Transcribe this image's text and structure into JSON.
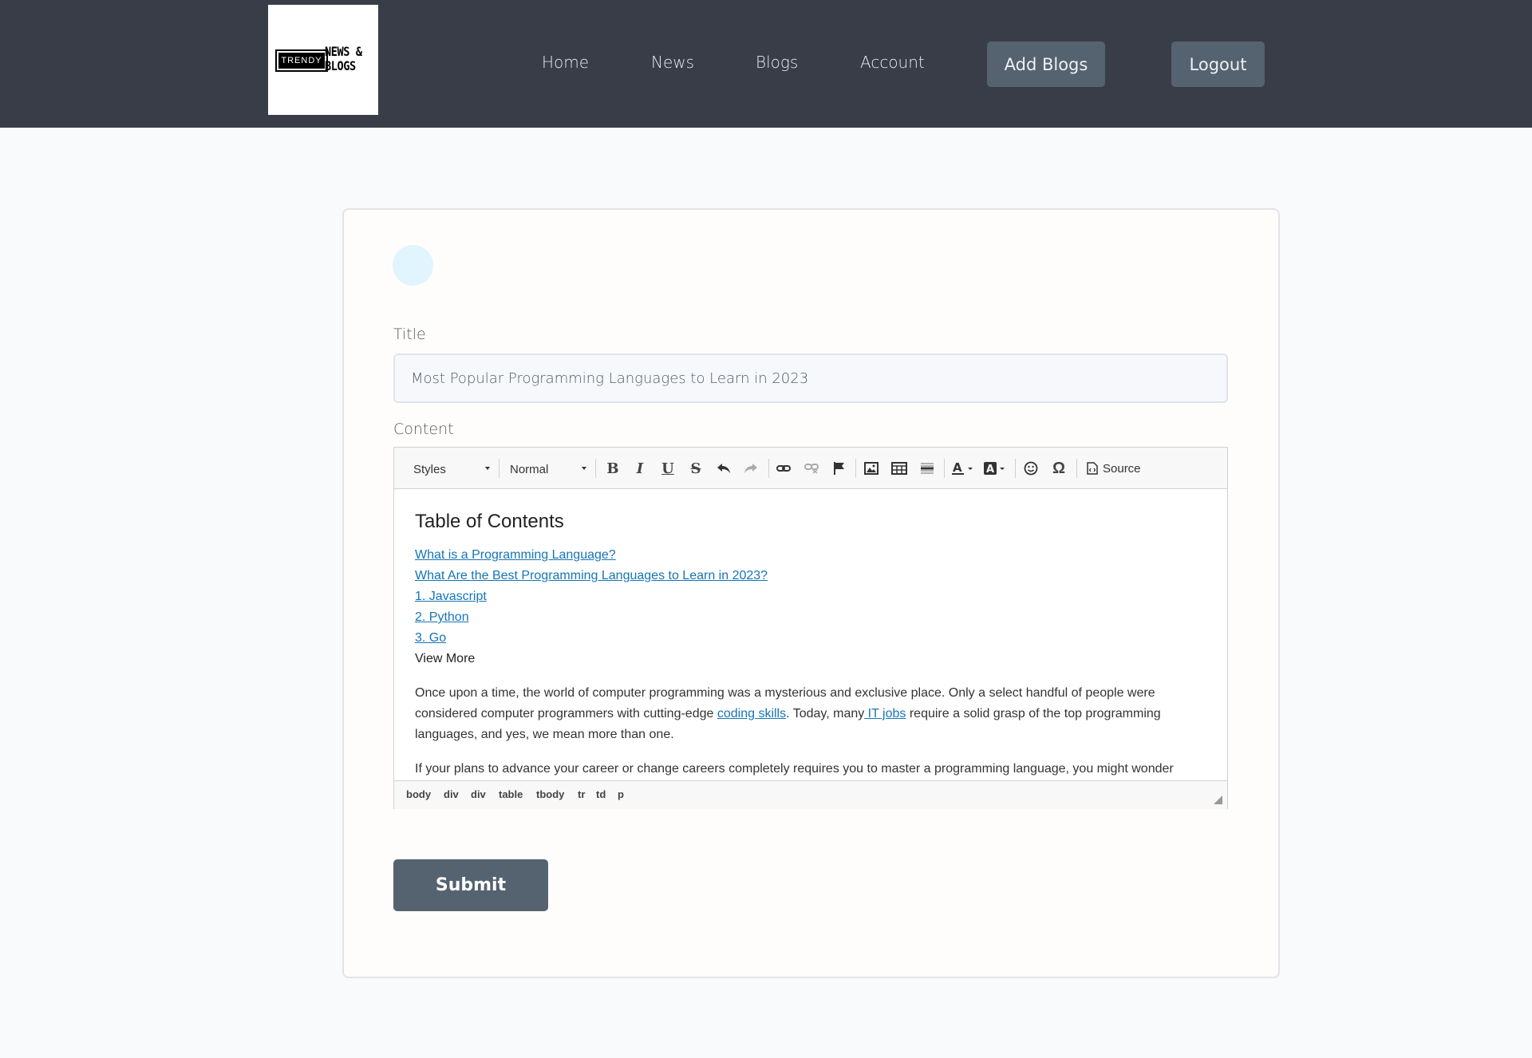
{
  "header": {
    "logo": {
      "badge": "TRENDY",
      "line1": "NEWS &",
      "line2": "BLOGS"
    },
    "nav": [
      "Home",
      "News",
      "Blogs",
      "Account"
    ],
    "add_blogs_label": "Add Blogs",
    "logout_label": "Logout"
  },
  "form": {
    "title_label": "Title",
    "title_value": "Most Popular Programming Languages to Learn in 2023",
    "content_label": "Content",
    "submit_label": "Submit"
  },
  "editor": {
    "toolbar": {
      "styles": "Styles",
      "format": "Normal",
      "source": "Source",
      "icons": [
        "bold-icon",
        "italic-icon",
        "underline-icon",
        "strikethrough-icon",
        "undo-icon",
        "redo-icon",
        "link-icon",
        "unlink-icon",
        "anchor-icon",
        "image-icon",
        "table-icon",
        "horizontal-rule-icon",
        "text-color-icon",
        "background-color-icon",
        "smiley-icon",
        "special-char-icon",
        "source-icon"
      ]
    },
    "heading": "Table of Contents",
    "toc": [
      "What is a Programming Language? ",
      "What Are the Best Programming Languages to Learn in 2023?",
      "1. Javascript",
      "2. Python",
      "3. Go"
    ],
    "view_more": "View More",
    "paragraph1": {
      "t1": "Once upon a time, the world of computer programming was a mysterious and exclusive place. Only a select handful of people were considered computer programmers with cutting-edge ",
      "link1": "coding skills",
      "t2": ". Today, many",
      "link2": " IT jobs",
      "t3": " require a solid grasp of the top programming languages, and yes, we mean more than one."
    },
    "paragraph2": "If your plans to advance your career or change careers completely requires you to master a programming language, you might wonder",
    "path": [
      "body",
      "div",
      "div",
      "table",
      "tbody",
      "tr",
      "td",
      "p"
    ]
  },
  "colors": {
    "header_bg": "#383d47",
    "button_bg": "#556370",
    "link": "#1575b7"
  }
}
